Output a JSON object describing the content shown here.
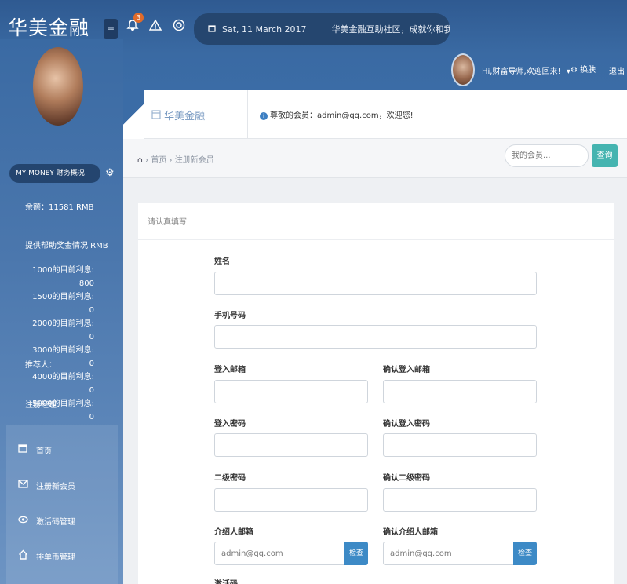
{
  "header": {
    "brand": "华美金融",
    "menu_toggle": "≡",
    "notification_count": "3",
    "date": "Sat, 11 March 2017",
    "news": "华美金融互助社区，成就你和我的财富梦...",
    "greeting": "Hi,财富导师,欢迎回来!",
    "greeting_caret": "▾",
    "switch_label": "换肤",
    "logout_label": "退出"
  },
  "sidebar": {
    "money_title": "MY MONEY 财务概况",
    "balance": "余额：11581 RMB",
    "help_income": "提供帮助奖金情况 RMB",
    "interest": [
      "1000的目前利息: 800",
      "1500的目前利息: 0",
      "2000的目前利息: 0",
      "3000的目前利息: 0",
      "4000的目前利息: 0",
      "5000的目前利息: 0"
    ],
    "referrer": "推荐人：",
    "manager": "注册经理：",
    "nav": [
      {
        "label": "首页",
        "icon": "calendar-icon"
      },
      {
        "label": "注册新会员",
        "icon": "envelope-icon"
      },
      {
        "label": "激活码管理",
        "icon": "eye-icon"
      },
      {
        "label": "排单币管理",
        "icon": "home-icon"
      }
    ]
  },
  "titlebar": {
    "title": "华美金融",
    "message": "尊敬的会员：admin@qq.com，欢迎您!"
  },
  "breadcrumb": {
    "home": "首页",
    "current": "注册新会员",
    "separator": "›"
  },
  "search": {
    "placeholder": "我的会员...",
    "button": "查询"
  },
  "form": {
    "header": "请认真填写",
    "name_label": "姓名",
    "phone_label": "手机号码",
    "email_label": "登入邮箱",
    "email_confirm_label": "确认登入邮箱",
    "password_label": "登入密码",
    "password_confirm_label": "确认登入密码",
    "pin_label": "二级密码",
    "pin_confirm_label": "确认二级密码",
    "referrer_email_label": "介绍人邮箱",
    "referrer_email_confirm_label": "确认介绍人邮箱",
    "referrer_email_value": "admin@qq.com",
    "referrer_email_confirm_value": "admin@qq.com",
    "verify_button": "检查",
    "next_label": "激活码"
  }
}
